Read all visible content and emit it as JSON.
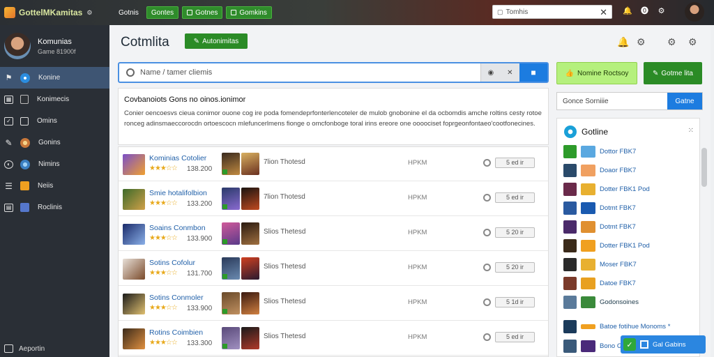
{
  "app": {
    "title": "GottelMKamitas"
  },
  "topnav": [
    {
      "label": "Gotnis",
      "style": "plain"
    },
    {
      "label": "Gontes",
      "style": "green"
    },
    {
      "label": "Gotnes",
      "style": "green"
    },
    {
      "label": "Gomkins",
      "style": "green"
    }
  ],
  "search_top": {
    "placeholder": "Tomhis"
  },
  "profile": {
    "name": "Komunias",
    "subtitle": "Game 81900f"
  },
  "sidebar": {
    "items": [
      {
        "label": "Konine",
        "active": true
      },
      {
        "label": "Konimecis"
      },
      {
        "label": "Omins"
      },
      {
        "label": "Gonins"
      },
      {
        "label": "Nimins"
      },
      {
        "label": "Neiis"
      },
      {
        "label": "Roclinis"
      }
    ],
    "footer": "Aeportin"
  },
  "main": {
    "title": "Cotmlita",
    "add_button": "Autonimitas",
    "search": {
      "placeholder": "Name / tamer cliemis"
    },
    "description": {
      "title": "Covbanoiots Gons no oinos.ionimor",
      "text": "Conier oencoesvs cieua conimor ouone cog ire poda fomendeprfonterlencoteler de mulob gnobonine el da ocbomdis amche roltins cesty rotoe ronceg adinsmaeccorocdn ortoescocn mlefuncerlmens fionge o omcfonboge toral irins ereore one oooociset foprgeonfontaeo'cootfonecines."
    },
    "rows": [
      {
        "name": "Kominias Cotolier",
        "stars": "★★★☆☆",
        "score": "138.200",
        "label": "7lion Thotesd",
        "code": "HPKM",
        "pill": "5 ed ir"
      },
      {
        "name": "Smie hotalifolbion",
        "stars": "★★★☆☆",
        "score": "133.200",
        "label": "7lion Thotesd",
        "code": "HPKM",
        "pill": "5 ed ir"
      },
      {
        "name": "Soains Conmbon",
        "stars": "★★★☆☆",
        "score": "133.900",
        "label": "Slios Thetesd",
        "code": "HPKM",
        "pill": "5 20 ir"
      },
      {
        "name": "Sotins Cofolur",
        "stars": "★★★☆☆",
        "score": "131.700",
        "label": "Slios Thetesd",
        "code": "HPKM",
        "pill": "5 20 ir"
      },
      {
        "name": "Sotins Conmoler",
        "stars": "★★★☆☆",
        "score": "133.900",
        "label": "Slios Thetesd",
        "code": "HPKM",
        "pill": "5 1d ir"
      },
      {
        "name": "Rotins Coimbien",
        "stars": "★★★☆☆",
        "score": "133.300",
        "label": "Slios Thetesd",
        "code": "HPKM",
        "pill": "5 ed ir"
      }
    ]
  },
  "right": {
    "btn_a": "Nomine Roctsoy",
    "btn_b": "Gotme lita",
    "search": {
      "placeholder": "Gonce Sorniiie",
      "button": "Gatne"
    },
    "panel": {
      "title": "Gotline",
      "items": [
        "Dottor FBK7",
        "Doaor FBK7",
        "Dotter FBK1 Pod",
        "Dotmt FBK7",
        "Dotmt FBK7",
        "Dotter FBK1 Pod",
        "Moser FBK7",
        "Datoe FBK7",
        "Godonsoines",
        "Batoe fotihue Monoms *",
        "Bono Gotbo"
      ]
    }
  },
  "toast": {
    "label": "Gal Gabins"
  }
}
